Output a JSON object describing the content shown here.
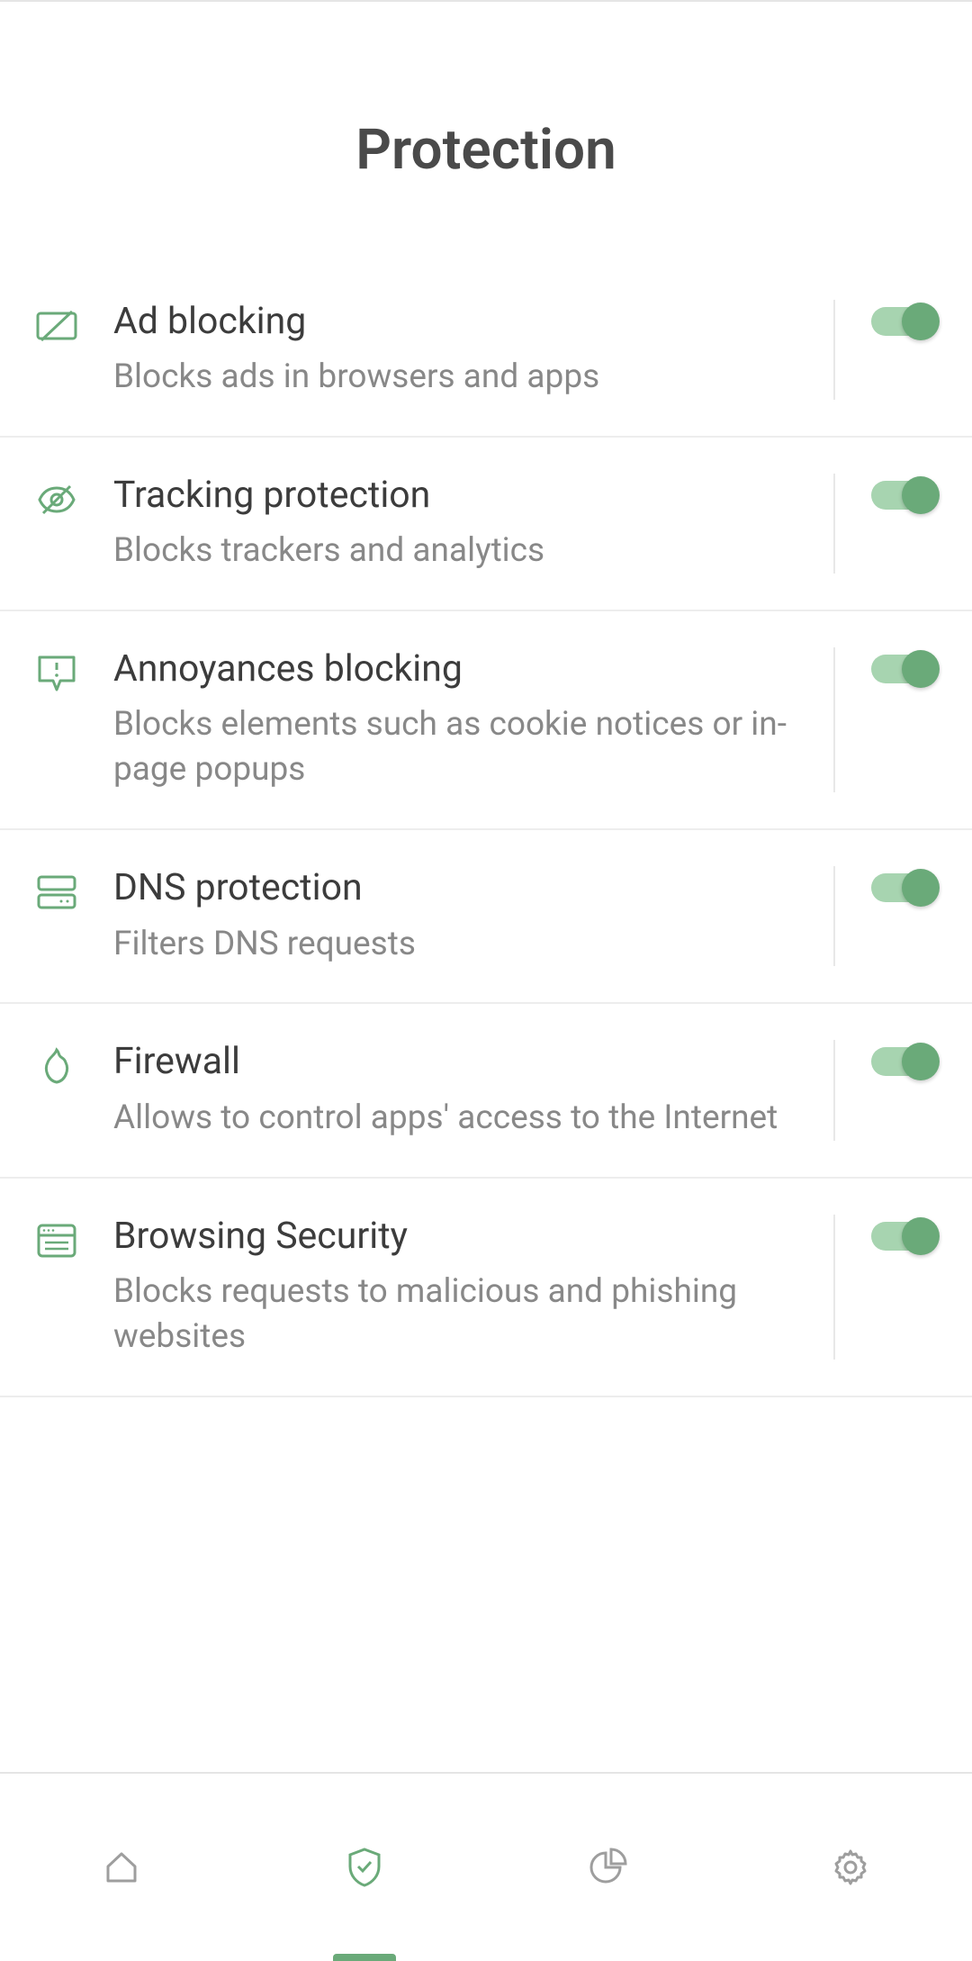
{
  "header": {
    "title": "Protection"
  },
  "items": [
    {
      "title": "Ad blocking",
      "desc": "Blocks ads in browsers and apps",
      "icon": "adblock-icon",
      "toggle": true
    },
    {
      "title": "Tracking protection",
      "desc": "Blocks trackers and analytics",
      "icon": "eye-slash-icon",
      "toggle": true
    },
    {
      "title": "Annoyances blocking",
      "desc": "Blocks elements such as cookie notices or in-page popups",
      "icon": "annoyance-icon",
      "toggle": true
    },
    {
      "title": "DNS protection",
      "desc": "Filters DNS requests",
      "icon": "dns-icon",
      "toggle": true
    },
    {
      "title": "Firewall",
      "desc": "Allows to control apps' access to the Internet",
      "icon": "firewall-icon",
      "toggle": true
    },
    {
      "title": "Browsing Security",
      "desc": "Blocks requests to malicious and phishing websites",
      "icon": "browser-icon",
      "toggle": true
    }
  ],
  "colors": {
    "accent": "#6aaa79",
    "accentLight": "#a7d4b0",
    "iconGreen": "#6aaa79"
  }
}
